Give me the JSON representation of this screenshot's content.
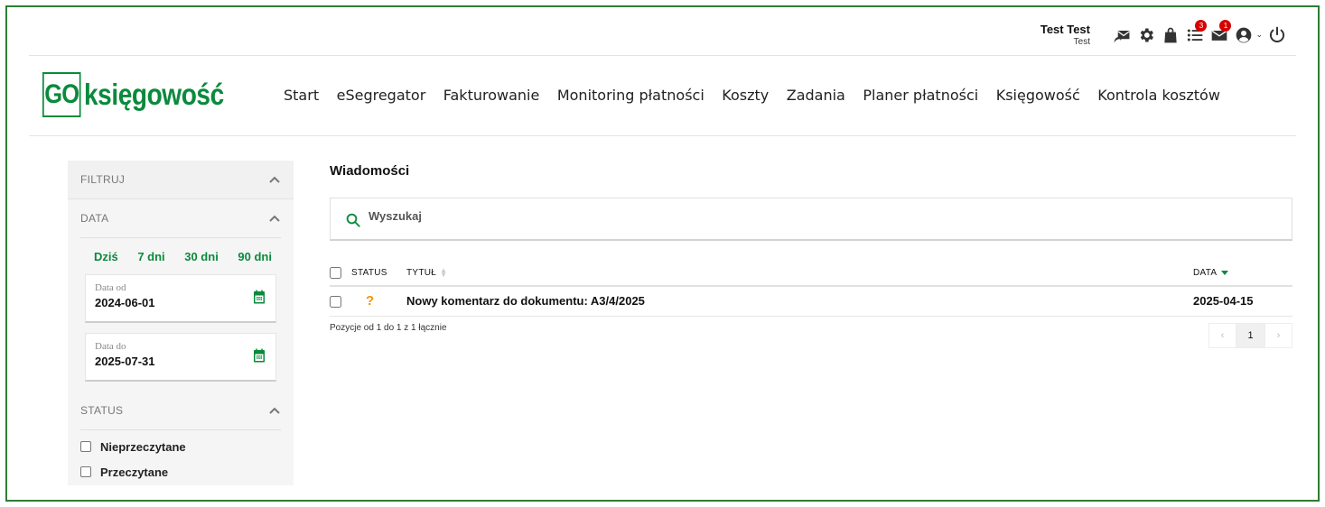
{
  "user": {
    "name": "Test Test",
    "company": "Test"
  },
  "header_icons": [
    {
      "name": "mail-reply-icon"
    },
    {
      "name": "gear-icon"
    },
    {
      "name": "shopping-bag-icon"
    },
    {
      "name": "tasks-list-icon",
      "badge": "3"
    },
    {
      "name": "envelope-icon",
      "badge": "1"
    },
    {
      "name": "user-circle-icon"
    },
    {
      "name": "power-icon"
    }
  ],
  "logo": {
    "go": "GO",
    "text": "księgowość"
  },
  "nav": [
    "Start",
    "eSegregator",
    "Fakturowanie",
    "Monitoring płatności",
    "Koszty",
    "Zadania",
    "Planer płatności",
    "Księgowość",
    "Kontrola kosztów"
  ],
  "sidebar": {
    "filter_title": "FILTRUJ",
    "date_title": "DATA",
    "quick_ranges": [
      "Dziś",
      "7 dni",
      "30 dni",
      "90 dni"
    ],
    "date_from": {
      "label": "Data od",
      "value": "2024-06-01"
    },
    "date_to": {
      "label": "Data do",
      "value": "2025-07-31"
    },
    "status_title": "STATUS",
    "status_options": [
      "Nieprzeczytane",
      "Przeczytane"
    ]
  },
  "main": {
    "title": "Wiadomości",
    "search_placeholder": "Wyszukaj",
    "columns": {
      "status": "STATUS",
      "title": "TYTUŁ",
      "date": "DATA"
    },
    "rows": [
      {
        "status": "?",
        "title": "Nowy komentarz do dokumentu: A3/4/2025",
        "date": "2025-04-15"
      }
    ],
    "info": "Pozycje od 1 do 1 z 1 łącznie",
    "pager": {
      "prev": "‹",
      "current": "1",
      "next": "›"
    }
  },
  "colors": {
    "brand": "#0a8a3c",
    "badge": "#d50000",
    "status_unknown": "#f39200",
    "frame": "#2e7d32"
  }
}
